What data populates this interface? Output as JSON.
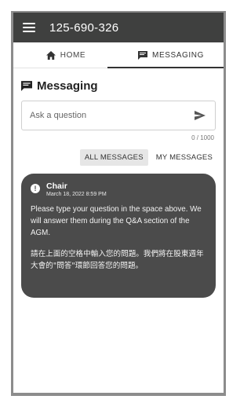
{
  "header": {
    "meeting_id": "125-690-326"
  },
  "tabs": [
    {
      "label": "HOME",
      "icon": "home-icon",
      "active": false
    },
    {
      "label": "MESSAGING",
      "icon": "chat-icon",
      "active": true
    }
  ],
  "messaging": {
    "title": "Messaging",
    "input_placeholder": "Ask a question",
    "char_counter": "0 / 1000",
    "filters": {
      "all": "ALL MESSAGES",
      "mine": "MY MESSAGES"
    }
  },
  "messages": [
    {
      "author": "Chair",
      "date": "March 18, 2022 8:59 PM",
      "body_en": "Please type your question in the space above. We will answer them during the Q&A section of the AGM.",
      "body_zh": "請在上面的空格中輸入您的問題。我們將在股東週年大會的\"問答\"環節回答您的問題。"
    }
  ],
  "colors": {
    "topbar": "#3f403f",
    "card": "#4b4b4b",
    "frame": "#8c8c8c"
  }
}
